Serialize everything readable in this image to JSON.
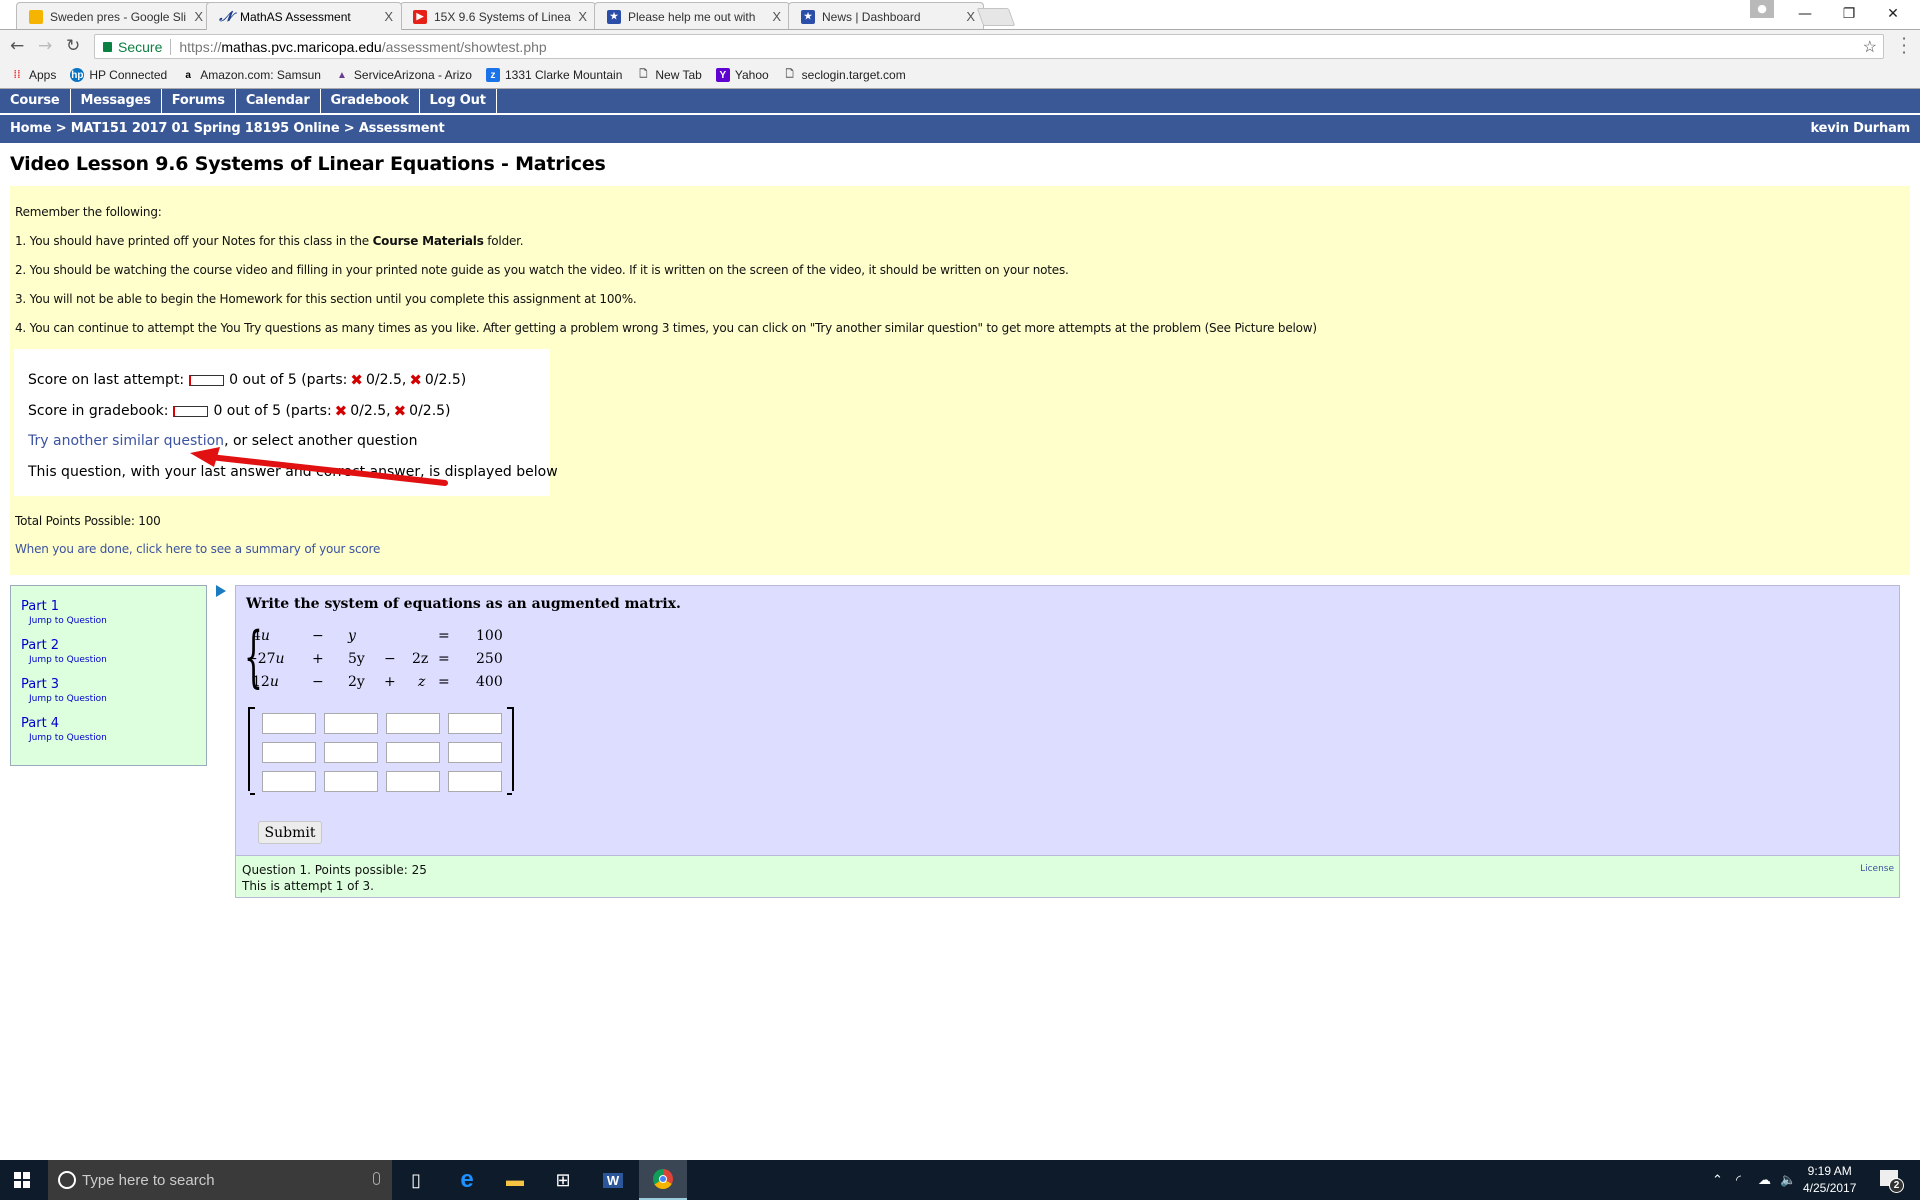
{
  "browser": {
    "tabs": [
      {
        "title": "Sweden pres - Google Sli",
        "icon": "google-slides-icon",
        "color": "#f4b400"
      },
      {
        "title": "MathAS Assessment",
        "icon": "mathas-icon",
        "color": "#1c3e8a",
        "active": true
      },
      {
        "title": "15X 9.6 Systems of Linea",
        "icon": "youtube-icon",
        "color": "#e62117"
      },
      {
        "title": "Please help me out with",
        "icon": "shield-star-icon",
        "color": "#2b4fa8"
      },
      {
        "title": "News | Dashboard",
        "icon": "shield-star-icon",
        "color": "#2b4fa8"
      }
    ],
    "close_glyph": "X",
    "address": {
      "secure_label": "Secure",
      "protocol": "https://",
      "host": "mathas.pvc.maricopa.edu",
      "path": "/assessment/showtest.php"
    },
    "bookmarks": [
      {
        "label": "Apps",
        "icon": "apps-grid-icon"
      },
      {
        "label": "HP Connected",
        "icon": "hp-icon"
      },
      {
        "label": "Amazon.com: Samsun",
        "icon": "amazon-icon"
      },
      {
        "label": "ServiceArizona - Arizo",
        "icon": "servicearizona-icon"
      },
      {
        "label": "1331 Clarke Mountain",
        "icon": "zillow-icon"
      },
      {
        "label": "New Tab",
        "icon": "page-icon"
      },
      {
        "label": "Yahoo",
        "icon": "yahoo-icon"
      },
      {
        "label": "seclogin.target.com",
        "icon": "page-icon"
      }
    ]
  },
  "nav": {
    "items": [
      "Course",
      "Messages",
      "Forums",
      "Calendar",
      "Gradebook",
      "Log Out"
    ]
  },
  "breadcrumb": {
    "items": [
      "Home",
      "MAT151 2017 01 Spring 18195 Online",
      "Assessment"
    ],
    "separator": ">",
    "user": "kevin Durham"
  },
  "page_title": "Video Lesson 9.6 Systems of Linear Equations - Matrices",
  "intro": {
    "heading": "Remember the following:",
    "items": [
      {
        "prefix": "1.  You should have printed off your Notes for this class in the ",
        "bold": "Course Materials",
        "suffix": " folder."
      },
      {
        "text": "2.  You should be watching the course video and filling in your printed note guide as you watch the video.  If it is written on the screen of the video, it should be written on your notes."
      },
      {
        "text": "3.  You will not be able to begin the Homework for this section until you complete this assignment at 100%."
      },
      {
        "text": "4.  You can continue to attempt the You Try questions as many times as you like. After getting a problem wrong 3 times, you can click on \"Try another similar question\" to get more attempts at the problem (See Picture below)"
      }
    ],
    "score_last": {
      "label": "Score on last attempt:",
      "score": "0 out of 5 (parts:",
      "part1": "0/2.5,",
      "part2": "0/2.5)",
      "progress": 0
    },
    "score_gradebook": {
      "label": "Score in gradebook:",
      "score": "0 out of 5 (parts:",
      "part1": "0/2.5,",
      "part2": "0/2.5)",
      "progress": 0
    },
    "try_link": "Try another similar question",
    "try_suffix": ", or select another question",
    "display_note": "This question, with your last answer and correct answer, is displayed below",
    "total_points": "Total Points Possible: 100",
    "summary_link": "When you are done, click here to see a summary of your score"
  },
  "parts": [
    {
      "label": "Part 1",
      "jump": "Jump to Question"
    },
    {
      "label": "Part 2",
      "jump": "Jump to Question"
    },
    {
      "label": "Part 3",
      "jump": "Jump to Question"
    },
    {
      "label": "Part 4",
      "jump": "Jump to Question"
    }
  ],
  "question": {
    "prompt": "Write the system of equations as an augmented matrix.",
    "system": [
      [
        "4",
        "u",
        "−",
        "y",
        "",
        "",
        "=",
        "100"
      ],
      [
        "−27",
        "u",
        "+",
        "5y",
        "−",
        "2z",
        "=",
        "250"
      ],
      [
        "12",
        "u",
        "−",
        "2y",
        "+",
        "z",
        "=",
        "400"
      ]
    ],
    "matrix": {
      "rows": 3,
      "cols": 4,
      "values": [
        [
          "",
          "",
          "",
          ""
        ],
        [
          "",
          "",
          "",
          ""
        ],
        [
          "",
          "",
          "",
          ""
        ]
      ]
    },
    "submit_label": "Submit",
    "footer_line1": "Question 1. Points possible: 25",
    "footer_line2": "This is attempt 1 of 3.",
    "license": "License"
  },
  "taskbar": {
    "search_placeholder": "Type here to search",
    "time": "9:19 AM",
    "date": "4/25/2017",
    "notifications": "2"
  }
}
